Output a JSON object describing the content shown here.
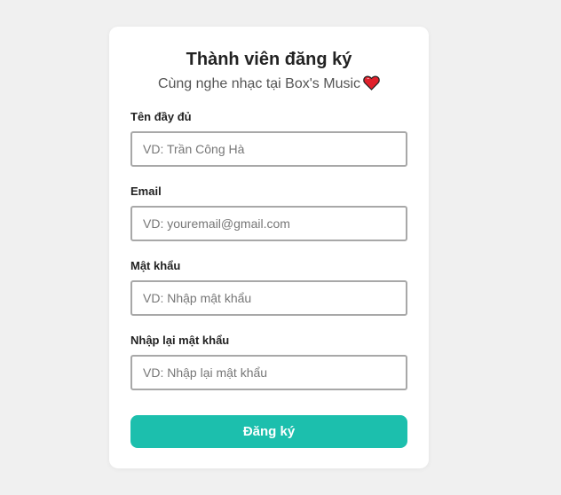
{
  "form": {
    "title": "Thành viên đăng ký",
    "subtitle": "Cùng nghe nhạc tại Box's Music",
    "subtitle_icon": "heart-icon",
    "fields": [
      {
        "label": "Tên đầy đủ",
        "placeholder": "VD: Trần Công Hà",
        "value": ""
      },
      {
        "label": "Email",
        "placeholder": "VD: youremail@gmail.com",
        "value": ""
      },
      {
        "label": "Mật khẩu",
        "placeholder": "VD: Nhập mật khẩu",
        "value": ""
      },
      {
        "label": "Nhập lại mật khẩu",
        "placeholder": "VD: Nhập lại mật khẩu",
        "value": ""
      }
    ],
    "submit_label": "Đăng ký"
  },
  "colors": {
    "background": "#f0f0f0",
    "card": "#ffffff",
    "accent": "#1cbfad",
    "heart": "#e0202b",
    "input_border": "#a8a8a8"
  }
}
